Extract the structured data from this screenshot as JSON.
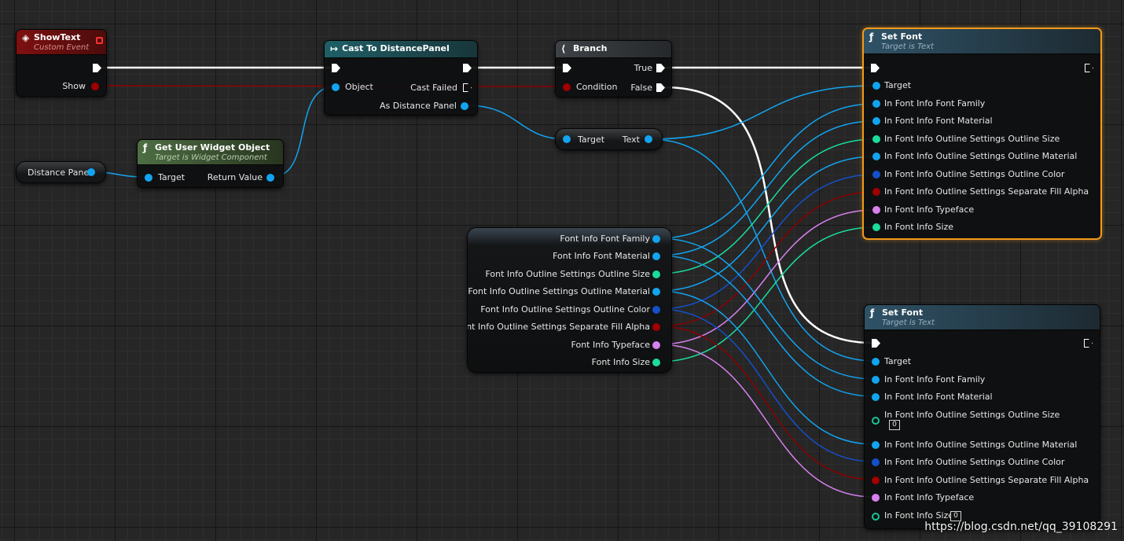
{
  "colors": {
    "exec": "#ffffff",
    "object": "#12a4f0",
    "bool": "#a00000",
    "int": "#1bdc9a",
    "color": "#1450c8",
    "font": "#d880f0",
    "selection": "#f29a1b"
  },
  "nodes": {
    "showtext": {
      "title": "ShowText",
      "subtitle": "Custom Event",
      "icon": "event-diamond-icon",
      "pin_show": "Show"
    },
    "cast": {
      "title": "Cast To DistancePanel",
      "icon": "cast-arrow-icon",
      "pin_object": "Object",
      "pin_cast_failed": "Cast Failed",
      "pin_as": "As Distance Panel"
    },
    "branch": {
      "title": "Branch",
      "icon": "branch-icon",
      "pin_condition": "Condition",
      "pin_true": "True",
      "pin_false": "False"
    },
    "get_widget": {
      "title": "Get User Widget Object",
      "subtitle": "Target is Widget Component",
      "icon": "function-icon",
      "pin_target": "Target",
      "pin_return": "Return Value"
    },
    "distance_panel": {
      "label": "Distance Panel"
    },
    "get_text": {
      "pin_target": "Target",
      "pin_text": "Text"
    },
    "break_font": {
      "pins": [
        "Font Info Font Family",
        "Font Info Font Material",
        "Font Info Outline Settings Outline Size",
        "Font Info Outline Settings Outline Material",
        "Font Info Outline Settings Outline Color",
        "Font Info Outline Settings Separate Fill Alpha",
        "Font Info Typeface",
        "Font Info Size"
      ]
    },
    "set_font_1": {
      "title": "Set Font",
      "subtitle": "Target is Text",
      "icon": "function-icon",
      "pins": [
        "Target",
        "In Font Info Font Family",
        "In Font Info Font Material",
        "In Font Info Outline Settings Outline Size",
        "In Font Info Outline Settings Outline Material",
        "In Font Info Outline Settings Outline Color",
        "In Font Info Outline Settings Separate Fill Alpha",
        "In Font Info Typeface",
        "In Font Info Size"
      ]
    },
    "set_font_2": {
      "title": "Set Font",
      "subtitle": "Target is Text",
      "icon": "function-icon",
      "pins": [
        "Target",
        "In Font Info Font Family",
        "In Font Info Font Material",
        "In Font Info Outline Settings Outline Size",
        "In Font Info Outline Settings Outline Material",
        "In Font Info Outline Settings Outline Color",
        "In Font Info Outline Settings Separate Fill Alpha",
        "In Font Info Typeface",
        "In Font Info Size"
      ],
      "outline_size_value": "0",
      "size_value": "0"
    }
  },
  "watermark": "https://blog.csdn.net/qq_39108291"
}
